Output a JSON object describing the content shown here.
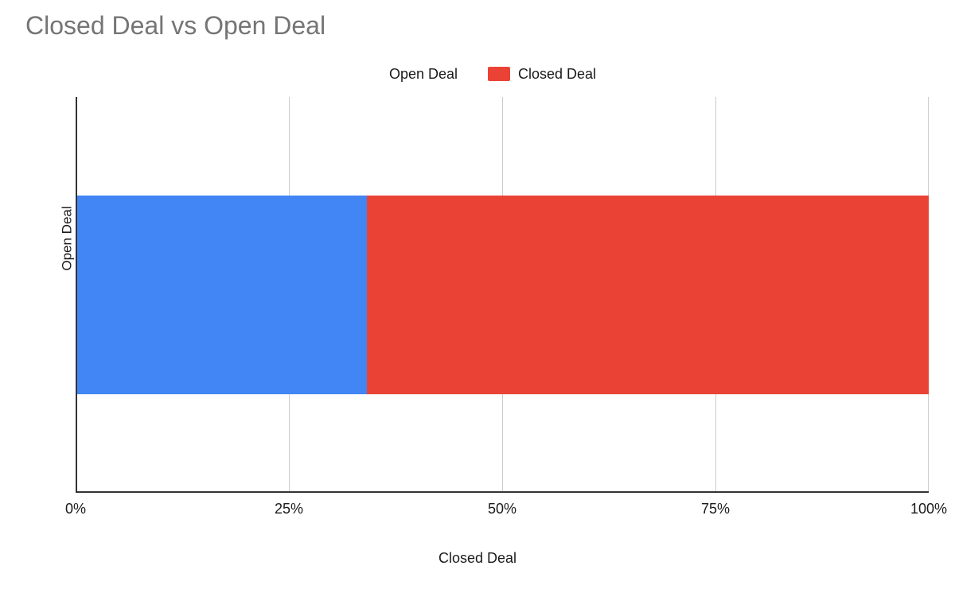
{
  "chart_data": {
    "type": "bar",
    "orientation": "horizontal_stacked_100pct",
    "title": "Closed Deal vs Open Deal",
    "xlabel": "Closed Deal",
    "x_ticks_pct": [
      0,
      25,
      50,
      75,
      100
    ],
    "x_tick_labels": [
      "0%",
      "25%",
      "50%",
      "75%",
      "100%"
    ],
    "y_category_label": "Open Deal",
    "series": [
      {
        "name": "Open Deal",
        "color": "#4285F4",
        "value_pct": 34
      },
      {
        "name": "Closed Deal",
        "color": "#EA4335",
        "value_pct": 66
      }
    ],
    "legend_position": "top-center"
  }
}
